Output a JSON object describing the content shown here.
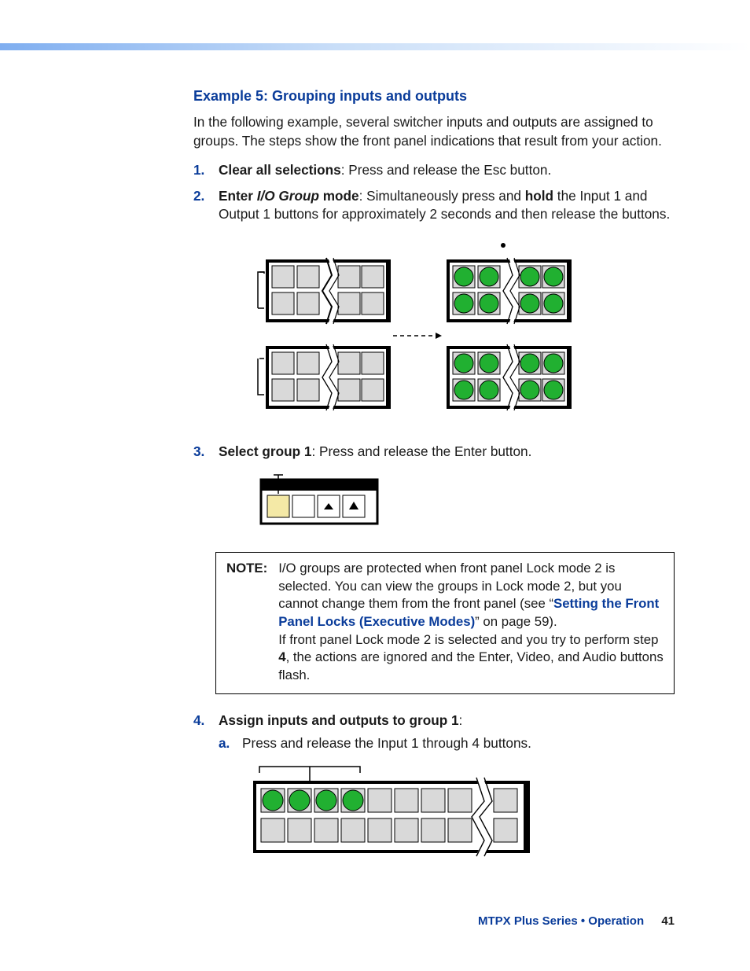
{
  "heading": "Example 5: Grouping inputs and outputs",
  "intro": "In the following example, several switcher inputs and outputs are assigned to groups. The steps show the front panel indications that result from your action.",
  "step1_num": "1.",
  "step1_bold": "Clear all selections",
  "step1_rest": ": Press and release the Esc button.",
  "step2_num": "2.",
  "step2_bold": "Enter ",
  "step2_italic": "I/O Group",
  "step2_bold2": " mode",
  "step2_rest": ": Simultaneously press and ",
  "step2_hold": "hold",
  "step2_rest2": " the Input 1 and Output 1 buttons for approximately 2 seconds and then release the buttons.",
  "step3_num": "3.",
  "step3_bold": "Select group 1",
  "step3_rest": ": Press and release the Enter button.",
  "note_label": "NOTE:",
  "note_l1": "I/O groups are protected when front panel Lock mode 2 is selected. You can view the groups in Lock mode 2, but you cannot change them from the front panel (see “",
  "note_link": "Setting the Front Panel Locks (Executive Modes)",
  "note_l1b": "” on page 59).",
  "note_l2a": "If front panel Lock mode 2 is selected and you try to perform step ",
  "note_l2b": "4",
  "note_l2c": ", the actions are ignored and the Enter, Video, and Audio buttons flash.",
  "step4_num": "4.",
  "step4_bold": "Assign inputs and outputs to group 1",
  "step4_colon": ":",
  "step4a_al": "a.",
  "step4a": "Press and release the Input 1 through 4 buttons.",
  "footer_title": "MTPX Plus Series • Operation",
  "page_number": "41"
}
